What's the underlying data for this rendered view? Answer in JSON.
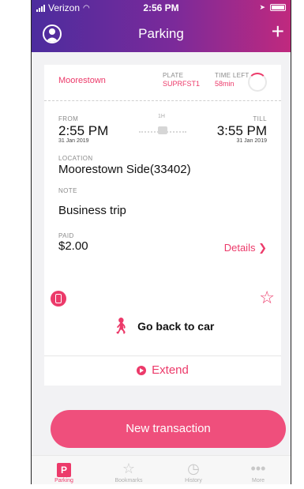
{
  "status_bar": {
    "carrier": "Verizon",
    "time": "2:56 PM"
  },
  "header": {
    "title": "Parking"
  },
  "summary": {
    "zone": "Moorestown",
    "plate_label": "PLATE",
    "plate_value": "SUPRFST1",
    "time_left_label": "TIME LEFT",
    "time_left_value": "58min"
  },
  "parking": {
    "from_label": "FROM",
    "from_time": "2:55 PM",
    "from_date": "31 Jan 2019",
    "duration_label": "1H",
    "till_label": "TILL",
    "till_time": "3:55 PM",
    "till_date": "31 Jan 2019",
    "location_label": "LOCATION",
    "location_value": "Moorestown Side(33402)",
    "note_label": "NOTE",
    "note_value": "Business trip",
    "paid_label": "PAID",
    "paid_value": "$2.00",
    "details_link": "Details"
  },
  "actions": {
    "go_back": "Go back to car",
    "extend": "Extend",
    "new_transaction": "New transaction"
  },
  "tabs": [
    {
      "label": "Parking",
      "icon": "parking-icon",
      "active": true
    },
    {
      "label": "Bookmarks",
      "icon": "star-icon",
      "active": false
    },
    {
      "label": "History",
      "icon": "clock-icon",
      "active": false
    },
    {
      "label": "More",
      "icon": "more-icon",
      "active": false
    }
  ],
  "colors": {
    "accent": "#ec3a6a",
    "header_gradient_start": "#4c2c9e",
    "header_gradient_end": "#c0297e"
  }
}
